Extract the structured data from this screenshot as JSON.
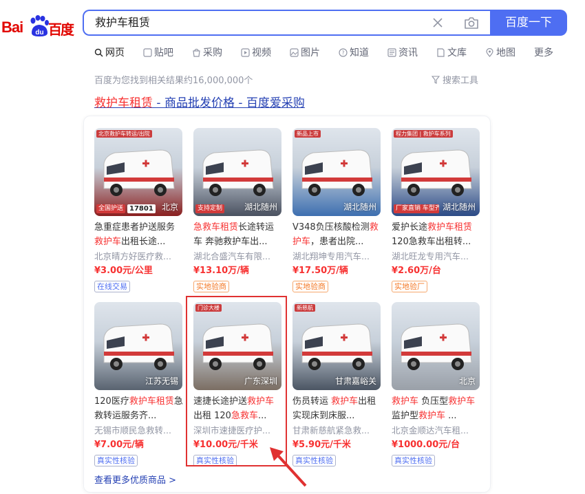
{
  "logo": {
    "bai": "Bai",
    "baidu_cn": "百度",
    "du": "du"
  },
  "search": {
    "query": "救护车租赁",
    "button_label": "百度一下"
  },
  "tabs": [
    {
      "label": "网页",
      "icon": "search-icon"
    },
    {
      "label": "贴吧",
      "icon": "tieba-icon"
    },
    {
      "label": "采购",
      "icon": "purchase-icon"
    },
    {
      "label": "视频",
      "icon": "video-icon"
    },
    {
      "label": "图片",
      "icon": "image-icon"
    },
    {
      "label": "知道",
      "icon": "question-icon"
    },
    {
      "label": "资讯",
      "icon": "news-icon"
    },
    {
      "label": "文库",
      "icon": "doc-icon"
    },
    {
      "label": "地图",
      "icon": "map-icon"
    },
    {
      "label": "更多",
      "icon": ""
    }
  ],
  "result_count": "百度为您找到相关结果约16,000,000个",
  "search_tools": "搜索工具",
  "result": {
    "title_highlight": "救护车租赁",
    "title_rest": " - 商品批发价格 - 百度爱采购"
  },
  "products": [
    {
      "title_parts": [
        [
          "急重症患者护送服务",
          0
        ],
        [
          "救护车",
          1
        ],
        [
          "出租长途...",
          0
        ]
      ],
      "seller": "北京晴方好医疗救...",
      "price": "¥3.00元/公里",
      "tag": "在线交易",
      "tag_style": "blue",
      "location": "北京",
      "color": "#8a1f1f",
      "top_label": "北京救护车转运/出院",
      "bottom_label_left": "全国护送",
      "bottom_number": "17801"
    },
    {
      "title_parts": [
        [
          "急",
          1
        ],
        [
          "救车租赁",
          1
        ],
        [
          "长途转运车 奔驰救护车出...",
          0
        ]
      ],
      "seller": "湖北合盛汽车有限...",
      "price": "¥13.10万/辆",
      "tag": "实地验商",
      "tag_style": "orange",
      "location": "湖北随州",
      "color": "#4a5160",
      "bottom_label_left": "支持定制"
    },
    {
      "title_parts": [
        [
          "V348负压核酸检测",
          0
        ],
        [
          "救护车",
          1
        ],
        [
          "，患者出院...",
          0
        ]
      ],
      "seller": "湖北翔坤专用汽车...",
      "price": "¥17.50万/辆",
      "tag": "实地验商",
      "tag_style": "orange",
      "location": "湖北随州",
      "color": "#3d6fb0",
      "top_label": "新品上市"
    },
    {
      "title_parts": [
        [
          "爱护长途",
          0
        ],
        [
          "救护车租赁",
          1
        ],
        [
          "120急救车出租转...",
          0
        ]
      ],
      "seller": "湖北旺龙专用汽车...",
      "price": "¥2.60万/台",
      "tag": "实地验厂",
      "tag_style": "orange",
      "location": "湖北随州",
      "color": "#2b4a86",
      "top_label": "程力集团 | 救护车系列",
      "bottom_label_left": "厂家直销 车型齐全"
    },
    {
      "title_parts": [
        [
          "120医疗",
          0
        ],
        [
          "救护车租赁",
          1
        ],
        [
          "急救转运服务齐...",
          0
        ]
      ],
      "seller": "无锡市顺民急救转...",
      "price": "¥7.00元/辆",
      "tag": "真实性核验",
      "tag_style": "blue",
      "location": "江苏无锡",
      "color": "#596370"
    },
    {
      "title_parts": [
        [
          "速捷长途护送",
          0
        ],
        [
          "救护车",
          1
        ],
        [
          "出租 120",
          0
        ],
        [
          "急救车",
          1
        ],
        [
          "...",
          0
        ]
      ],
      "seller": "深圳市速捷医疗护...",
      "price": "¥10.00元/千米",
      "tag": "真实性核验",
      "tag_style": "blue",
      "location": "广东深圳",
      "color": "#7b6e63",
      "top_label": "门诊大楼"
    },
    {
      "title_parts": [
        [
          "伤员转运 ",
          0
        ],
        [
          "救护车",
          1
        ],
        [
          "出租实现床到床服...",
          0
        ]
      ],
      "seller": "甘肃新慈航紧急救...",
      "price": "¥5.90元/千米",
      "tag": "真实性核验",
      "tag_style": "blue",
      "location": "甘肃嘉峪关",
      "color": "#4b5563",
      "top_label": "新慈航"
    },
    {
      "title_parts": [
        [
          "救护车",
          1
        ],
        [
          " 负压型",
          0
        ],
        [
          "救护车",
          1
        ],
        [
          "监护型",
          0
        ],
        [
          "救护车",
          1
        ],
        [
          " ...",
          0
        ]
      ],
      "seller": "北京金顺达汽车租...",
      "price": "¥1000.00元/台",
      "tag": "真实性核验",
      "tag_style": "blue",
      "location": "北京",
      "color": "#9aa0a8"
    }
  ],
  "more_link": "查看更多优质商品 >"
}
